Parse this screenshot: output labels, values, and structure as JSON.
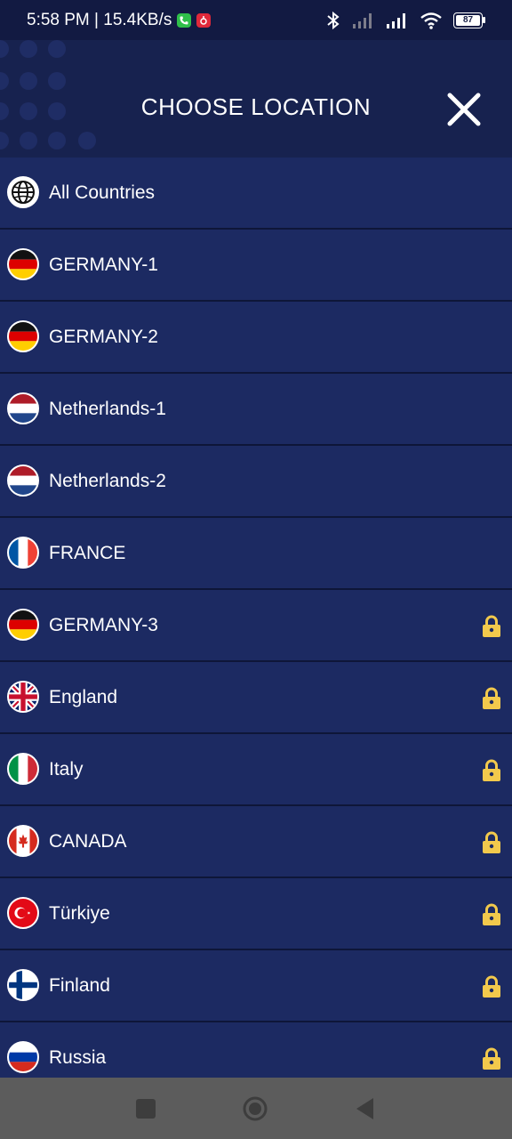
{
  "status_bar": {
    "time_speed": "5:58 PM | 15.4KB/s",
    "battery": "87"
  },
  "header": {
    "title": "CHOOSE LOCATION",
    "close_icon": "close-icon"
  },
  "locations": [
    {
      "label": "All Countries",
      "icon": "globe-icon",
      "locked": false
    },
    {
      "label": "GERMANY-1",
      "icon": "germany-flag-icon",
      "locked": false
    },
    {
      "label": "GERMANY-2",
      "icon": "germany-flag-icon",
      "locked": false
    },
    {
      "label": "Netherlands-1",
      "icon": "netherlands-flag-icon",
      "locked": false
    },
    {
      "label": "Netherlands-2",
      "icon": "netherlands-flag-icon",
      "locked": false
    },
    {
      "label": "FRANCE",
      "icon": "france-flag-icon",
      "locked": false
    },
    {
      "label": "GERMANY-3",
      "icon": "germany-flag-icon",
      "locked": true
    },
    {
      "label": "England",
      "icon": "uk-flag-icon",
      "locked": true
    },
    {
      "label": "Italy",
      "icon": "italy-flag-icon",
      "locked": true
    },
    {
      "label": "CANADA",
      "icon": "canada-flag-icon",
      "locked": true
    },
    {
      "label": "Türkiye",
      "icon": "turkey-flag-icon",
      "locked": true
    },
    {
      "label": "Finland",
      "icon": "finland-flag-icon",
      "locked": true
    },
    {
      "label": "Russia",
      "icon": "russia-flag-icon",
      "locked": true
    }
  ],
  "colors": {
    "background": "#1c2a62",
    "header": "#17224f",
    "separator": "#0e1638",
    "lock": "#f2c94c"
  }
}
